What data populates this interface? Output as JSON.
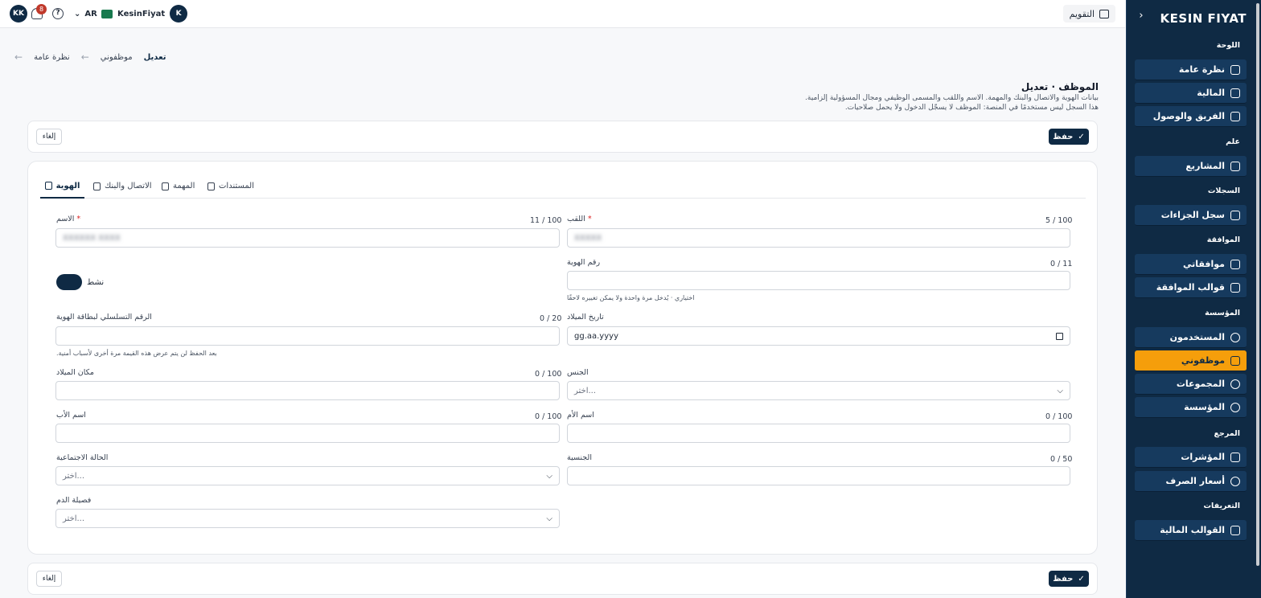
{
  "topbar": {
    "user_initials": "KK",
    "notifications_count": "8",
    "language": "AR",
    "username": "KesinFiyat",
    "user_badge": "K",
    "calendar_label": "التقويم"
  },
  "sidebar": {
    "brand": "KESIN FIYAT",
    "sections": [
      {
        "label": "اللوحة"
      },
      {
        "label": "علم"
      },
      {
        "label": "السجلات"
      },
      {
        "label": "الموافقة"
      },
      {
        "label": "المؤسسة"
      },
      {
        "label": "المرجع"
      },
      {
        "label": "التعريفات"
      }
    ],
    "items": [
      {
        "label": "نظرة عامة",
        "icon": "home-icon"
      },
      {
        "label": "المالية",
        "icon": "wallet-icon"
      },
      {
        "label": "الفريق والوصول",
        "icon": "shield-icon"
      },
      {
        "label": "المشاريع",
        "icon": "folder-icon"
      },
      {
        "label": "سجل الجزاءات",
        "icon": "file-icon"
      },
      {
        "label": "موافقاتي",
        "icon": "clipboard-icon"
      },
      {
        "label": "قوالب الموافقة",
        "icon": "branch-icon"
      },
      {
        "label": "المستخدمون",
        "icon": "user-icon"
      },
      {
        "label": "موظفوني",
        "icon": "badge-icon"
      },
      {
        "label": "المجموعات",
        "icon": "users-icon"
      },
      {
        "label": "المؤسسة",
        "icon": "building-icon"
      },
      {
        "label": "المؤشرات",
        "icon": "chart-icon"
      },
      {
        "label": "أسعار الصرف",
        "icon": "globe-icon"
      },
      {
        "label": "القوالب المالية",
        "icon": "external-icon"
      }
    ],
    "active_color": "#f59e0b",
    "bg_color": "#0f2a44"
  },
  "breadcrumb": {
    "items": [
      "نظرة عامة",
      "موظفوني",
      "تعديل"
    ]
  },
  "page": {
    "title": "الموظف · تعديل",
    "subtitle_1": "بيانات الهوية والاتصال والبنك والمهمة. الاسم واللقب والمسمى الوظيفي ومجال المسؤولية إلزامية.",
    "subtitle_2": "هذا السجل ليس مستخدمًا في المنصة: الموظف لا يسجّل الدخول ولا يحمل صلاحيات.",
    "save_label": "حفظ",
    "cancel_label": "إلغاء"
  },
  "tabs": [
    {
      "label": "الهوية"
    },
    {
      "label": "الاتصال والبنك"
    },
    {
      "label": "المهمة"
    },
    {
      "label": "المستندات"
    }
  ],
  "form": {
    "surname": {
      "label": "اللقب",
      "count": "5 / 100",
      "value": "XXXXX"
    },
    "name": {
      "label": "الاسم",
      "count": "11 / 100",
      "value": "XXXXXX XXXX"
    },
    "id_number": {
      "label": "رقم الهوية",
      "count": "0 / 11",
      "hint": "اختياري · يُدخل مرة واحدة ولا يمكن تغييره لاحقًا"
    },
    "active": {
      "label": "نشط"
    },
    "birth_date": {
      "label": "تاريخ الميلاد",
      "placeholder": "gg.aa.yyyy"
    },
    "id_serial": {
      "label": "الرقم التسلسلي لبطاقة الهوية",
      "count": "0 / 20",
      "hint": "بعد الحفظ لن يتم عرض هذه القيمة مرة أخرى لأسباب أمنية."
    },
    "gender": {
      "label": "الجنس",
      "placeholder": "اختر..."
    },
    "birth_place": {
      "label": "مكان الميلاد",
      "count": "0 / 100"
    },
    "mother_name": {
      "label": "اسم الأم",
      "count": "0 / 100"
    },
    "father_name": {
      "label": "اسم الأب",
      "count": "0 / 100"
    },
    "nationality": {
      "label": "الجنسية",
      "count": "0 / 50"
    },
    "marital_status": {
      "label": "الحالة الاجتماعية",
      "placeholder": "اختر..."
    },
    "blood_type": {
      "label": "فصيلة الدم",
      "placeholder": "اختر..."
    }
  }
}
